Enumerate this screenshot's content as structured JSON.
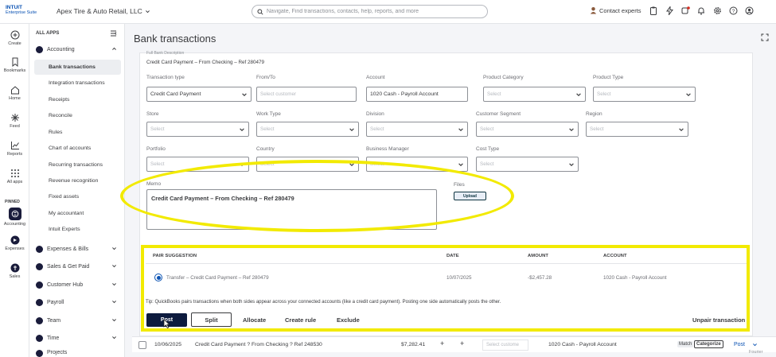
{
  "topbar": {
    "brand_line1": "INTUIT",
    "brand_line2": "Enterprise Suite",
    "company": "Apex Tire & Auto Retail, LLC",
    "search_placeholder": "Navigate, Find transactions, contacts, help, reports, and more",
    "contact_experts": "Contact experts"
  },
  "rail": {
    "items": [
      "Create",
      "Bookmarks",
      "Home",
      "Feed",
      "Reports",
      "All apps"
    ],
    "pinned_label": "PINNED",
    "pinned_items": [
      "Accounting",
      "Expenses",
      "Sales"
    ]
  },
  "nav": {
    "all_apps": "ALL APPS",
    "accounting": "Accounting",
    "accounting_items": [
      "Bank transactions",
      "Integration transactions",
      "Receipts",
      "Reconcile",
      "Rules",
      "Chart of accounts",
      "Recurring transactions",
      "Revenue recognition",
      "Fixed assets",
      "My accountant",
      "Intuit Experts"
    ],
    "sections": [
      "Expenses & Bills",
      "Sales & Get Paid",
      "Customer Hub",
      "Payroll",
      "Team",
      "Time",
      "Projects"
    ]
  },
  "page": {
    "title": "Bank transactions",
    "bank_description_label": "Full Bank Description",
    "bank_description": "Credit Card Payment – From Checking – Ref 280479"
  },
  "form": {
    "transaction_type_label": "Transaction type",
    "transaction_type_value": "Credit Card Payment",
    "from_to_label": "From/To",
    "from_to_placeholder": "Select customer",
    "account_label": "Account",
    "account_value": "1020 Cash - Payroll Account",
    "product_category_label": "Product Category",
    "product_type_label": "Product Type",
    "store_label": "Store",
    "work_type_label": "Work Type",
    "division_label": "Division",
    "customer_segment_label": "Customer Segment",
    "region_label": "Region",
    "portfolio_label": "Portfolio",
    "country_label": "Country",
    "business_manager_label": "Business Manager",
    "cost_type_label": "Cost Type",
    "select_placeholder": "Select",
    "memo_label": "Memo",
    "memo_value": "Credit Card Payment – From Checking – Ref 280479",
    "files_label": "Files",
    "upload_label": "Upload"
  },
  "pair": {
    "headers": [
      "PAIR SUGGESTION",
      "DATE",
      "AMOUNT",
      "ACCOUNT"
    ],
    "row": {
      "suggestion": "Transfer – Credit Card Payment – Ref 280479",
      "date": "10/07/2025",
      "amount": "-$2,457.28",
      "account": "1020 Cash - Payroll Account"
    },
    "tip": "Tip: QuickBooks pairs transactions when both sides appear across your connected accounts (like a credit card payment). Posting one side automatically posts the other."
  },
  "actions": {
    "post": "Post",
    "split": "Split",
    "allocate": "Allocate",
    "create_rule": "Create rule",
    "exclude": "Exclude",
    "unpair": "Unpair transaction"
  },
  "next_row": {
    "date": "10/06/2025",
    "description": "Credit Card Payment ? From Checking ? Ref 248530",
    "amount": "$7,282.41",
    "plus1": "+",
    "plus2": "+",
    "select_customer": "Select custome",
    "account": "1020 Cash - Payroll Account",
    "match": "Match",
    "categorize": "Categorize",
    "post": "Post"
  },
  "watermark": "Fourier",
  "colors": {
    "brand": "#0a52b3",
    "post_button": "#0d1b3e",
    "annotation": "#f2ea00"
  }
}
